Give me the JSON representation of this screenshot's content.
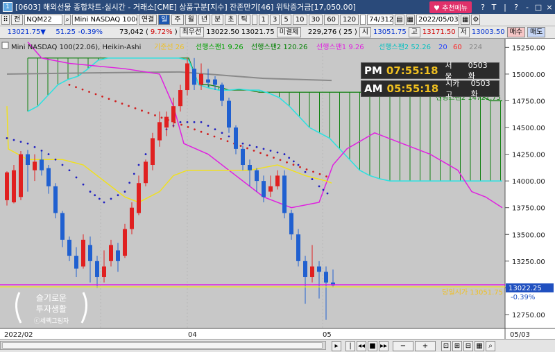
{
  "titlebar": {
    "icon": "1",
    "title": "[0603] 해외선물 종합차트-실시간 - 거래소[CME] 상품구분[지수] 잔존만기[46] 위탁증거금[17,050.00]",
    "recommend_label": "추천메뉴",
    "buttons": [
      "?",
      "T",
      "|",
      "?",
      "-",
      "□",
      "×"
    ]
  },
  "toolbar": {
    "menu_label": "전",
    "code": "NQM22",
    "name": "Mini NASDAQ 100(22.06)",
    "periods": [
      "연결",
      "일",
      "주",
      "월",
      "년",
      "분",
      "초",
      "틱"
    ],
    "numbers": [
      "1",
      "3",
      "5",
      "10",
      "30",
      "60",
      "120"
    ],
    "count": "74/312",
    "date": "2022/05/03"
  },
  "quote": {
    "price": "13021.75▼",
    "change": "51.25",
    "rate": "-0.39%",
    "volume": "73,042",
    "volume_rate": "9.72%",
    "best_ask_label": "최우선",
    "best_ask": "13022.50",
    "best_bid": "13021.75",
    "unfilled_label": "미결제",
    "unfilled": "229,276",
    "unfilled_chg": "25",
    "open_label": "시",
    "open": "13051.75",
    "high_label": "고",
    "high": "13171.50",
    "low_label": "저",
    "low": "13003.50",
    "buy_label": "매수",
    "sell_label": "매도"
  },
  "legend": {
    "title": "Mini NASDAQ 100(22.06), Heikin-Ashi",
    "items": [
      {
        "text": "기준선 26",
        "color": "#f0c020"
      },
      {
        "text": "선행스팬1 9.26",
        "color": "#00a000"
      },
      {
        "text": "선행스팬2 120.26",
        "color": "#008000"
      },
      {
        "text": "선행스팬1 9.26",
        "color": "#e020e0"
      },
      {
        "text": "선행스팬2 52.26",
        "color": "#00c0c0"
      },
      {
        "text": "20",
        "color": "#2040ff"
      },
      {
        "text": "60",
        "color": "#ff2020"
      },
      {
        "text": "224",
        "color": "#888888"
      }
    ]
  },
  "clocks": [
    {
      "ampm": "PM",
      "time": "07:55:18",
      "city": "서 울",
      "date": "0503 화"
    },
    {
      "ampm": "AM",
      "time": "05:55:18",
      "city": "시카고",
      "date": "0503 화"
    }
  ],
  "yaxis": {
    "ticks": [
      "15250.00",
      "15000.00",
      "14750.00",
      "14500.00",
      "14250.00",
      "14000.00",
      "13750.00",
      "13500.00",
      "13250.00",
      "13000.00",
      "12750.00"
    ],
    "current_price_tag": "13022.25",
    "current_rate_tag": "-0.39%"
  },
  "overlay": {
    "current_line_label": "당일시가 13051.75",
    "span_label": "선행스팬2 14721.75"
  },
  "watermark": {
    "line1": "슬기로운",
    "line2": "투자생활",
    "line3": "ⓒ세렉그림자"
  },
  "xaxis": {
    "labels": [
      "2022/02",
      "04",
      "05",
      "05/03"
    ]
  },
  "colors": {
    "up": "#e02020",
    "down": "#2060d0",
    "background": "#c8c8c8",
    "cloud_green": "#108010",
    "cloud_cyan": "#30e0e0",
    "magenta": "#e020e0",
    "yellow": "#f0e020",
    "red_dots": "#d02020",
    "blue_dots": "#2020c0"
  },
  "chart_data": {
    "type": "candlestick",
    "title": "Mini NASDAQ 100(22.06), Heikin-Ashi",
    "ylim": [
      12620,
      15330
    ],
    "candles": [
      {
        "o": 13820,
        "c": 14080,
        "h": 14090,
        "l": 13770
      },
      {
        "o": 13800,
        "c": 14100,
        "h": 14150,
        "l": 13790
      },
      {
        "o": 13850,
        "c": 14250,
        "h": 14280,
        "l": 13820
      },
      {
        "o": 14250,
        "c": 14150,
        "h": 14290,
        "l": 13900
      },
      {
        "o": 14100,
        "c": 14180,
        "h": 14250,
        "l": 14000
      },
      {
        "o": 14200,
        "c": 14100,
        "h": 14280,
        "l": 14050
      },
      {
        "o": 14120,
        "c": 13950,
        "h": 14150,
        "l": 13880
      },
      {
        "o": 13950,
        "c": 13700,
        "h": 13980,
        "l": 13650
      },
      {
        "o": 13700,
        "c": 13450,
        "h": 13720,
        "l": 13380
      },
      {
        "o": 13450,
        "c": 13300,
        "h": 13480,
        "l": 13250
      },
      {
        "o": 13300,
        "c": 13180,
        "h": 13380,
        "l": 13100
      },
      {
        "o": 13200,
        "c": 13450,
        "h": 13500,
        "l": 13180
      },
      {
        "o": 13400,
        "c": 13250,
        "h": 13480,
        "l": 13050
      },
      {
        "o": 13250,
        "c": 13100,
        "h": 13300,
        "l": 13000
      },
      {
        "o": 13100,
        "c": 13200,
        "h": 13350,
        "l": 13050
      },
      {
        "o": 13250,
        "c": 13400,
        "h": 13450,
        "l": 13200
      },
      {
        "o": 13350,
        "c": 13250,
        "h": 13420,
        "l": 13150
      },
      {
        "o": 13300,
        "c": 13550,
        "h": 13600,
        "l": 13280
      },
      {
        "o": 13550,
        "c": 13750,
        "h": 13800,
        "l": 13500
      },
      {
        "o": 13700,
        "c": 13980,
        "h": 14050,
        "l": 13680
      },
      {
        "o": 13980,
        "c": 14180,
        "h": 14200,
        "l": 13950
      },
      {
        "o": 14150,
        "c": 14400,
        "h": 14450,
        "l": 14100
      },
      {
        "o": 14380,
        "c": 14550,
        "h": 14650,
        "l": 14320
      },
      {
        "o": 14500,
        "c": 14600,
        "h": 14650,
        "l": 14420
      },
      {
        "o": 14550,
        "c": 14700,
        "h": 14780,
        "l": 14500
      },
      {
        "o": 14700,
        "c": 14850,
        "h": 14900,
        "l": 14650
      },
      {
        "o": 14850,
        "c": 15100,
        "h": 15150,
        "l": 14800
      },
      {
        "o": 15050,
        "c": 14900,
        "h": 15150,
        "l": 14850
      },
      {
        "o": 14900,
        "c": 15000,
        "h": 15100,
        "l": 14850
      },
      {
        "o": 14950,
        "c": 14920,
        "h": 15050,
        "l": 14880
      },
      {
        "o": 14950,
        "c": 14900,
        "h": 14980,
        "l": 14850
      },
      {
        "o": 14900,
        "c": 14750,
        "h": 14920,
        "l": 14700
      },
      {
        "o": 14750,
        "c": 14500,
        "h": 14780,
        "l": 14450
      },
      {
        "o": 14500,
        "c": 14300,
        "h": 14520,
        "l": 14250
      },
      {
        "o": 14300,
        "c": 14150,
        "h": 14330,
        "l": 14100
      },
      {
        "o": 14150,
        "c": 14100,
        "h": 14200,
        "l": 13950
      },
      {
        "o": 14100,
        "c": 14000,
        "h": 14120,
        "l": 13900
      },
      {
        "o": 14000,
        "c": 13850,
        "h": 14050,
        "l": 13800
      },
      {
        "o": 13900,
        "c": 13950,
        "h": 14050,
        "l": 13850
      },
      {
        "o": 13950,
        "c": 14050,
        "h": 14100,
        "l": 13920
      },
      {
        "o": 14050,
        "c": 13700,
        "h": 14100,
        "l": 13650
      },
      {
        "o": 13700,
        "c": 13500,
        "h": 13730,
        "l": 13450
      },
      {
        "o": 13500,
        "c": 13250,
        "h": 13550,
        "l": 13200
      },
      {
        "o": 13250,
        "c": 13100,
        "h": 13300,
        "l": 12850
      },
      {
        "o": 13100,
        "c": 13200,
        "h": 13400,
        "l": 13050
      },
      {
        "o": 13200,
        "c": 13150,
        "h": 13250,
        "l": 12900
      },
      {
        "o": 13150,
        "c": 13050,
        "h": 13200,
        "l": 12700
      },
      {
        "o": 13050,
        "c": 13022,
        "h": 13172,
        "l": 13004
      }
    ]
  }
}
